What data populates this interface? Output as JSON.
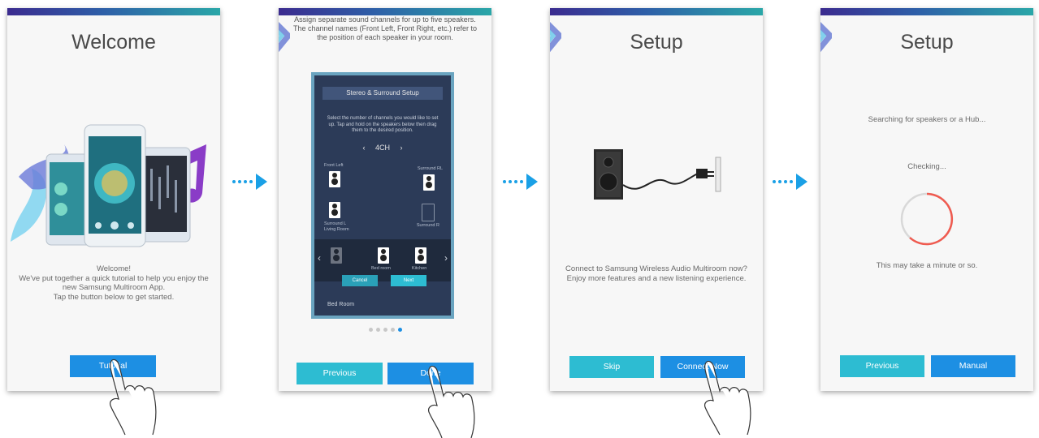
{
  "screen1": {
    "title": "Welcome",
    "body": "Welcome!\nWe've put together a quick tutorial to help you enjoy the new Samsung Multiroom App.\nTap the button below to get started.",
    "button": "Tutorial"
  },
  "screen2": {
    "intro": "Assign separate sound channels for up to five speakers. The channel names (Front Left, Front Right, etc.) refer to the position of each speaker in your room.",
    "inner_title": "Stereo & Surround Setup",
    "inner_desc": "Select the number of channels you would like to set up. Tap and hold on the speakers below then drag them to the desired position.",
    "channel": "4CH",
    "labels": {
      "front_left": "Front Left",
      "surround_rl": "Surround RL",
      "surround_l": "Surround L",
      "living_room": "Living Room",
      "surround_r": "Surround R",
      "bed_room": "Bed room",
      "kitchen": "Kitchen",
      "bed_room_bottom": "Bed Room"
    },
    "cancel": "Cancel",
    "next": "Next",
    "dots_total": 5,
    "dots_active": 5,
    "prev_button": "Previous",
    "done_button": "Done"
  },
  "screen3": {
    "title": "Setup",
    "body": "Connect to Samsung Wireless Audio Multiroom now? Enjoy more features and a new listening experience.",
    "skip_button": "Skip",
    "connect_button": "Connect Now"
  },
  "screen4": {
    "title": "Setup",
    "searching": "Searching for speakers or a Hub...",
    "checking": "Checking...",
    "note": "This may take a minute or so.",
    "prev_button": "Previous",
    "manual_button": "Manual"
  },
  "colors": {
    "primary_blue": "#1d8fe3",
    "teal": "#2dbcd2",
    "arrow": "#1aa0e6",
    "progress_red": "#f05a4f"
  }
}
